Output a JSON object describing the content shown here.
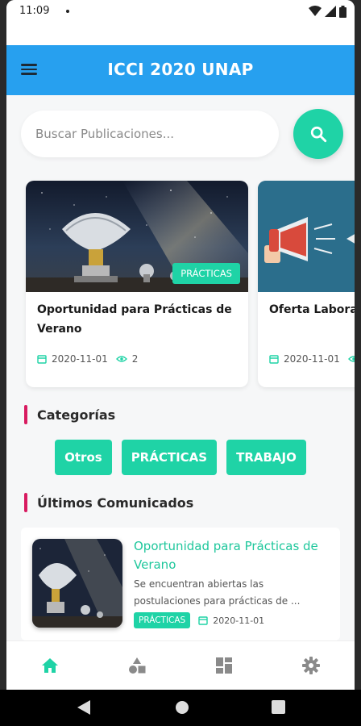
{
  "status_bar": {
    "time": "11:09"
  },
  "app_bar": {
    "title": "ICCI 2020 UNAP"
  },
  "search": {
    "placeholder": "Buscar Publicaciones..."
  },
  "carousel": [
    {
      "title": "Oportunidad para Prácticas de Verano",
      "tag": "PRÁCTICAS",
      "date": "2020-11-01",
      "views": "2"
    },
    {
      "title": "Oferta Laboral",
      "date": "2020-11-01"
    }
  ],
  "categories": {
    "heading": "Categorías",
    "items": [
      "Otros",
      "PRÁCTICAS",
      "TRABAJO"
    ]
  },
  "latest": {
    "heading": "Últimos Comunicados",
    "items": [
      {
        "title": "Oportunidad para Prácticas de Verano",
        "description": "Se encuentran abiertas las postulaciones para prácticas de ...",
        "tag": "PRÁCTICAS",
        "date": "2020-11-01"
      }
    ]
  },
  "bottom_nav": {
    "items": [
      {
        "icon": "home-icon",
        "active": true
      },
      {
        "icon": "categories-icon",
        "active": false
      },
      {
        "icon": "dashboard-icon",
        "active": false
      },
      {
        "icon": "settings-icon",
        "active": false
      }
    ]
  },
  "colors": {
    "accent": "#1fd3a6",
    "app_bar": "#27a0ef",
    "section_marker": "#d81b60"
  }
}
